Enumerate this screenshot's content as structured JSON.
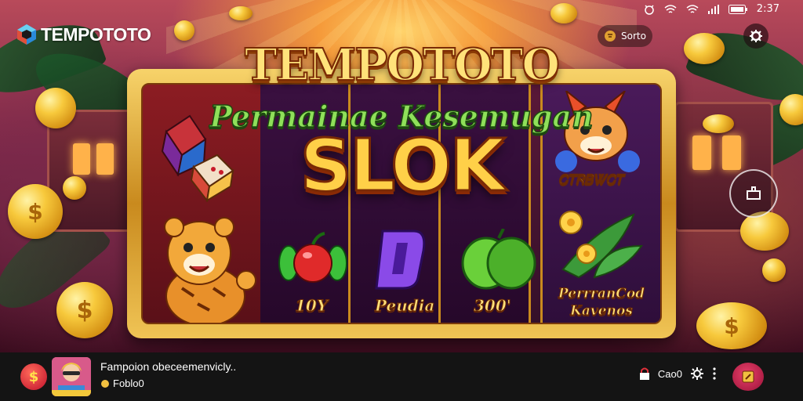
{
  "status_bar": {
    "time": "2:37",
    "icons": [
      "alarm-icon",
      "wifi-icon",
      "wifi-icon",
      "signal-icon",
      "battery-icon"
    ]
  },
  "header": {
    "logo_text": "TEMPOTOTO",
    "sort_button": {
      "label": "Sorto",
      "icon": "sort-icon"
    },
    "settings_button": {
      "icon": "gear-icon"
    }
  },
  "banner": {
    "title": "TEMPOTOTO",
    "subtitle": "Permainae Kesemugan",
    "headline": "SLOK",
    "symbols": [
      {
        "icon": "cherry-icon",
        "label": "10Y"
      },
      {
        "icon": "letter-d-icon",
        "label": "Peudia"
      },
      {
        "icon": "melon-icon",
        "label": "300'"
      }
    ],
    "right_reel": {
      "top_label": "ᏟᎢᏒᏴᏔᏟᎢ",
      "bottom_label": "PerrranCod Kavenos"
    }
  },
  "side_button": {
    "icon": "cast-icon"
  },
  "bottom_bar": {
    "coin_symbol": "$",
    "title": "Fampoion obeceemenvicly..",
    "subtitle": "Foblo0",
    "right_label": "Cao0",
    "more_icon": "more-vert-icon",
    "play_icon": "play-square-icon"
  },
  "colors": {
    "gold": "#f7c93c",
    "bar_bg": "#141414",
    "accent": "#c0102a",
    "green_text": "#8fe05a"
  }
}
